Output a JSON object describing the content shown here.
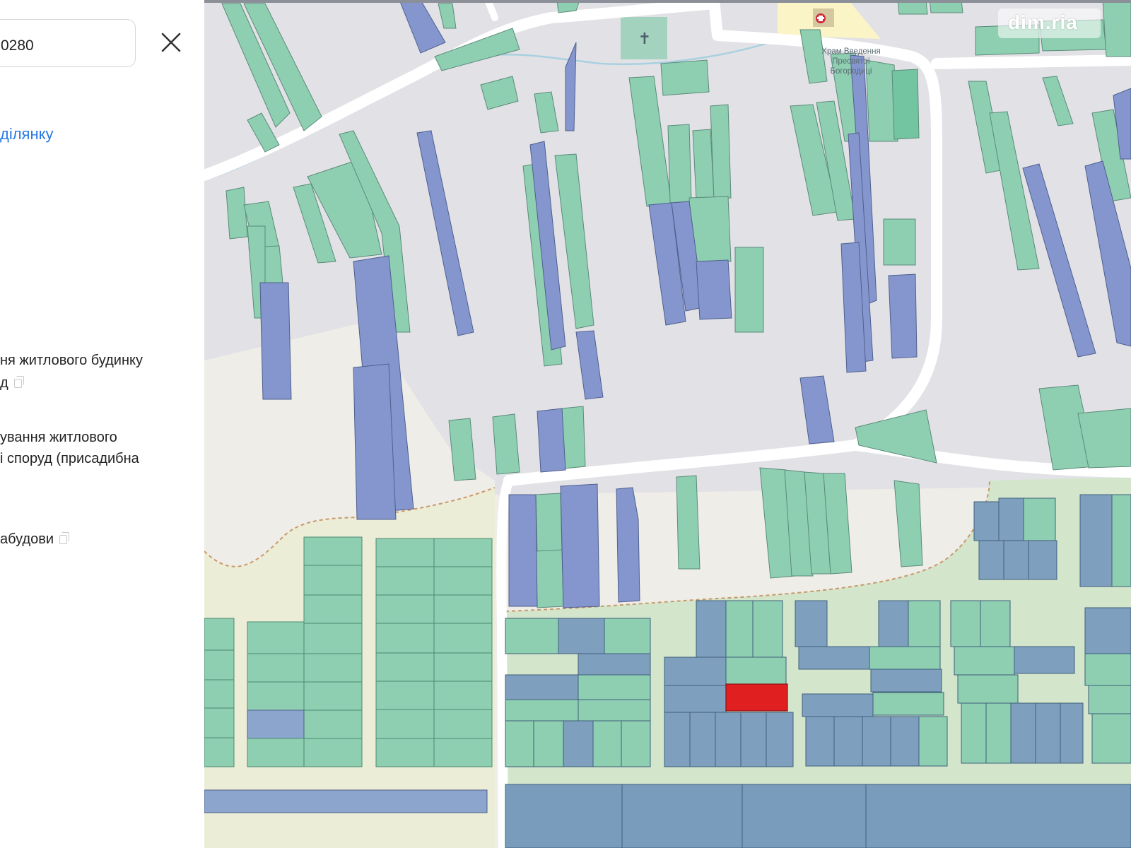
{
  "panel": {
    "search_value": "0280",
    "plot_link": "ділянку",
    "purpose_line1": "ня житлового будинку",
    "purpose_line2": "д",
    "usage_line1": "ування житлового",
    "usage_line2": "і споруд (присадибна",
    "category": "абудови"
  },
  "map": {
    "church_label_1": "Храм Введення",
    "church_label_2": "Пресвятої",
    "church_label_3": "Богородиці",
    "watermark": "dim.ria",
    "highlight_color": "#e02020",
    "building_green": "#8ecfb1",
    "building_blue": "#8496cd",
    "parcel_blue": "#7f9fbf"
  }
}
